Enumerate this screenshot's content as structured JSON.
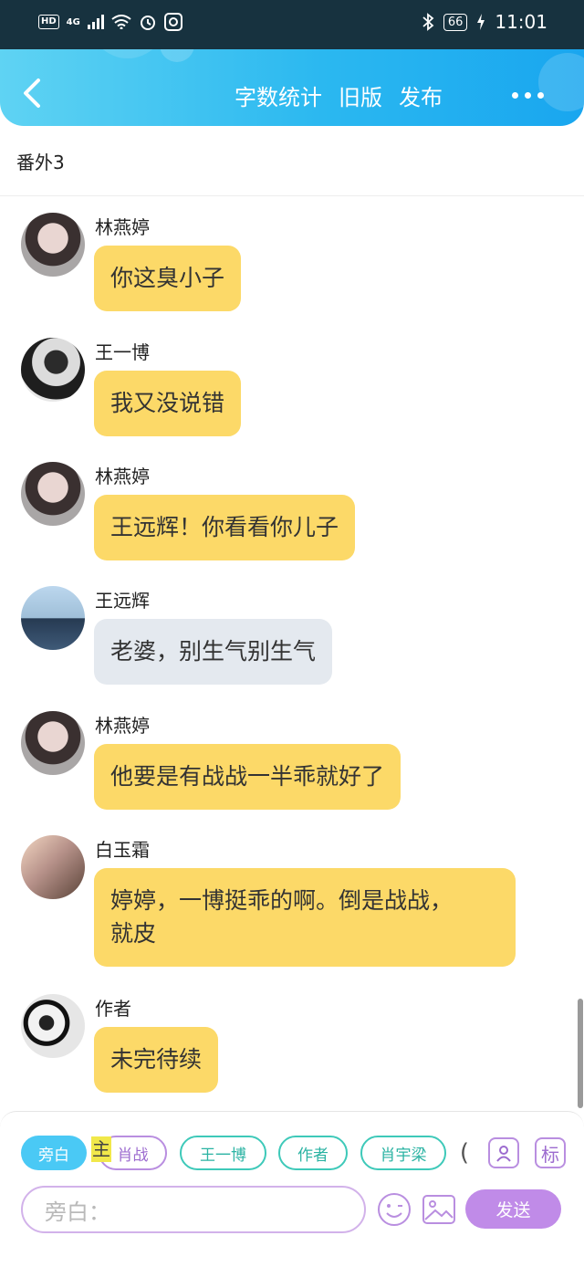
{
  "status_bar": {
    "left_badges": [
      "HD",
      "4G"
    ],
    "battery": "66",
    "time": "11:01"
  },
  "header": {
    "actions": [
      "字数统计",
      "旧版",
      "发布"
    ]
  },
  "chapter_title": "番外3",
  "messages": [
    {
      "sender": "林燕婷",
      "text": "你这臭小子",
      "style": "yellow"
    },
    {
      "sender": "王一博",
      "text": "我又没说错",
      "style": "yellow"
    },
    {
      "sender": "林燕婷",
      "text": "王远辉！你看看你儿子",
      "style": "yellow"
    },
    {
      "sender": "王远辉",
      "text": "老婆，别生气别生气",
      "style": "gray"
    },
    {
      "sender": "林燕婷",
      "text": "他要是有战战一半乖就好了",
      "style": "yellow"
    },
    {
      "sender": "白玉霜",
      "text_lines": [
        "婷婷，一博挺乖的啊。倒是战战，",
        "就皮"
      ],
      "style": "yellow"
    },
    {
      "sender": "作者",
      "text": "未完待续",
      "style": "yellow"
    }
  ],
  "role_bar": {
    "chips": [
      "旁白",
      "肖战",
      "王一博",
      "作者",
      "肖宇梁",
      "("
    ],
    "highlight": "主",
    "tag_label": "标"
  },
  "input": {
    "placeholder": "旁白："
  },
  "send_label": "发送",
  "colors": {
    "header_gradient_start": "#5fd3f3",
    "header_gradient_end": "#19a6ef",
    "bubble_yellow": "#fcd968",
    "bubble_gray": "#e4e9ef",
    "send_button": "#c08be8",
    "chip_active": "#4ac9f5",
    "chip_teal": "#3ec9b9"
  }
}
